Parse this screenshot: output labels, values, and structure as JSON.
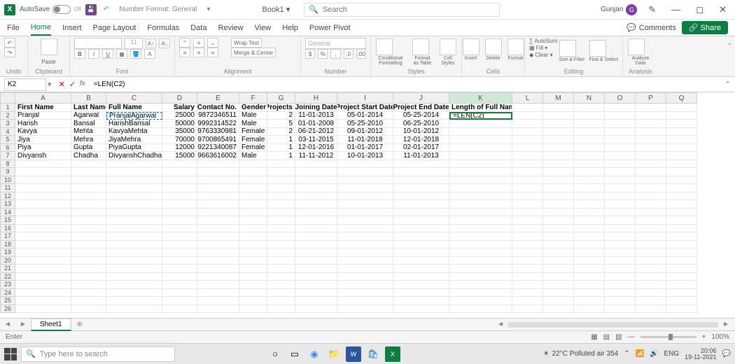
{
  "titlebar": {
    "autosave": "AutoSave",
    "off": "Off",
    "number_format": "Number Format: General",
    "book": "Book1 ▾",
    "search_placeholder": "Search",
    "user": "Gunjan",
    "user_initial": "G"
  },
  "tabs": {
    "file": "File",
    "home": "Home",
    "insert": "Insert",
    "pagelayout": "Page Layout",
    "formulas": "Formulas",
    "data": "Data",
    "review": "Review",
    "view": "View",
    "help": "Help",
    "powerpivot": "Power Pivot",
    "comments": "Comments",
    "share": "Share"
  },
  "ribbon": {
    "undo": "Undo",
    "clipboard": "Clipboard",
    "paste": "Paste",
    "font": "Font",
    "fontsize": "11",
    "alignment": "Alignment",
    "wrap": "Wrap Text",
    "merge": "Merge & Center",
    "number": "Number",
    "general": "General",
    "styles": "Styles",
    "cond": "Conditional Formatting",
    "fmttable": "Format as Table",
    "cellstyles": "Cell Styles",
    "cells": "Cells",
    "insert": "Insert",
    "delete": "Delete",
    "format": "Format",
    "editing": "Editing",
    "autosum": "AutoSum",
    "fill": "Fill",
    "clear": "Clear",
    "sort": "Sort & Filter",
    "find": "Find & Select",
    "analysis": "Analysis",
    "analyze": "Analyze Data"
  },
  "fbar": {
    "name": "K2",
    "formula": "=LEN(C2)"
  },
  "columns": [
    "A",
    "B",
    "C",
    "D",
    "E",
    "F",
    "G",
    "H",
    "I",
    "J",
    "K",
    "L",
    "M",
    "N",
    "O",
    "P",
    "Q"
  ],
  "headers": {
    "A": "First Name",
    "B": "Last Name",
    "C": "Full Name",
    "D": "Salary",
    "E": "Contact No.",
    "F": "Gender",
    "G": "Projects",
    "H": "Joining Date",
    "I": "Project Start Date",
    "J": "Project End Date",
    "K": "Length of Full Names"
  },
  "rows": [
    {
      "A": "Pranjal",
      "B": "Agarwal",
      "C": "PranjalAgarwal",
      "D": "25000",
      "E": "9872346511",
      "F": "Male",
      "G": "2",
      "H": "11-01-2013",
      "I": "05-01-2014",
      "J": "05-25-2014",
      "K": "=LEN(C2)"
    },
    {
      "A": "Harish",
      "B": "Bansal",
      "C": "HarishBansal",
      "D": "50000",
      "E": "9992314522",
      "F": "Male",
      "G": "5",
      "H": "01-01-2008",
      "I": "05-25-2010",
      "J": "06-25-2010",
      "K": ""
    },
    {
      "A": "Kavya",
      "B": "Mehta",
      "C": "KavyaMehta",
      "D": "35000",
      "E": "9763330981",
      "F": "Female",
      "G": "2",
      "H": "06-21-2012",
      "I": "09-01-2012",
      "J": "10-01-2012",
      "K": ""
    },
    {
      "A": "Jiya",
      "B": "Mehra",
      "C": "JiyaMehra",
      "D": "70000",
      "E": "9700865491",
      "F": "Female",
      "G": "1",
      "H": "03-11-2015",
      "I": "11-01-2018",
      "J": "12-01-2018",
      "K": ""
    },
    {
      "A": "Piya",
      "B": "Gupta",
      "C": "PiyaGupta",
      "D": "12000",
      "E": "9221340087",
      "F": "Female",
      "G": "1",
      "H": "12-01-2016",
      "I": "01-01-2017",
      "J": "02-01-2017",
      "K": ""
    },
    {
      "A": "Divyansh",
      "B": "Chadha",
      "C": "DivyanshChadha",
      "D": "15000",
      "E": "9663616002",
      "F": "Male",
      "G": "1",
      "H": "11-11-2012",
      "I": "10-01-2013",
      "J": "11-01-2013",
      "K": ""
    }
  ],
  "sheet": {
    "name": "Sheet1"
  },
  "status": {
    "mode": "Enter",
    "zoom": "100%"
  },
  "taskbar": {
    "search": "Type here to search",
    "weather": "22°C  Polluted air 354",
    "lang": "ENG",
    "time": "20:06",
    "date": "19-11-2021"
  }
}
